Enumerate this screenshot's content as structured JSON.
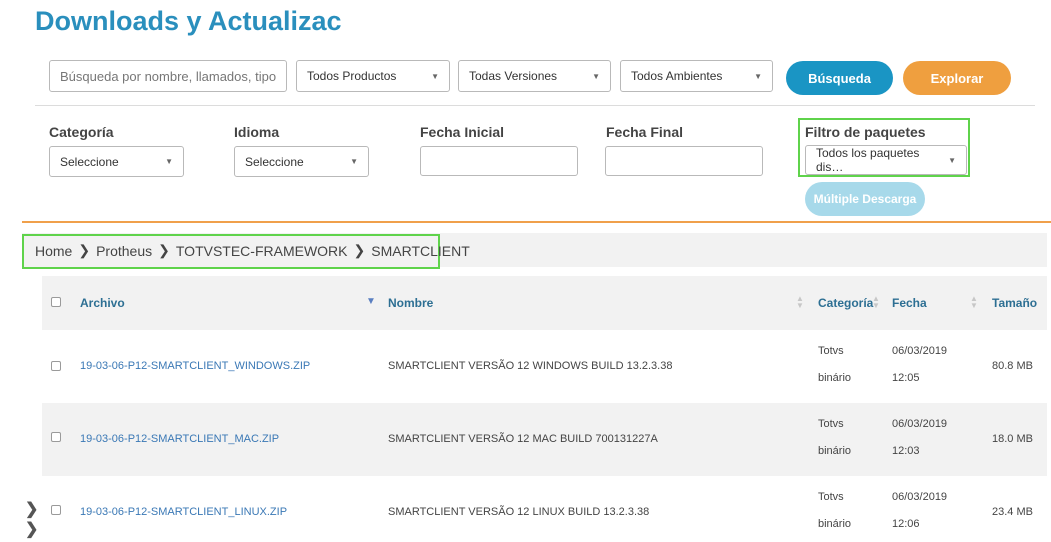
{
  "page": {
    "title": "Downloads y Actualizac"
  },
  "search": {
    "placeholder": "Búsqueda por nombre, llamados, tipo .",
    "products_select": "Todos Productos",
    "versions_select": "Todas Versiones",
    "environments_select": "Todos Ambientes",
    "search_button": "Búsqueda",
    "explore_button": "Explorar"
  },
  "filters": {
    "category_label": "Categoría",
    "category_value": "Seleccione",
    "language_label": "Idioma",
    "language_value": "Seleccione",
    "start_date_label": "Fecha Inicial",
    "end_date_label": "Fecha Final",
    "package_filter_label": "Filtro de paquetes",
    "package_filter_value": "Todos los paquetes dis…",
    "multi_download_button": "Múltiple Descarga"
  },
  "breadcrumb": [
    "Home",
    "Protheus",
    "TOTVSTEC-FRAMEWORK",
    "SMARTCLIENT"
  ],
  "table": {
    "headers": {
      "file": "Archivo",
      "name": "Nombre",
      "category": "Categoría",
      "date": "Fecha",
      "size": "Tamaño"
    },
    "rows": [
      {
        "file": "19-03-06-P12-SMARTCLIENT_WINDOWS.ZIP",
        "name": "SMARTCLIENT VERSÃO 12 WINDOWS BUILD 13.2.3.38",
        "category_line1": "Totvs",
        "category_line2": "binário",
        "date": "06/03/2019",
        "time": "12:05",
        "size": "80.8 MB"
      },
      {
        "file": "19-03-06-P12-SMARTCLIENT_MAC.ZIP",
        "name": "SMARTCLIENT VERSÃO 12 MAC BUILD 700131227A",
        "category_line1": "Totvs",
        "category_line2": "binário",
        "date": "06/03/2019",
        "time": "12:03",
        "size": "18.0 MB"
      },
      {
        "file": "19-03-06-P12-SMARTCLIENT_LINUX.ZIP",
        "name": "SMARTCLIENT VERSÃO 12 LINUX BUILD 13.2.3.38",
        "category_line1": "Totvs",
        "category_line2": "binário",
        "date": "06/03/2019",
        "time": "12:06",
        "size": "23.4 MB"
      }
    ]
  },
  "colors": {
    "title": "#2a8fbd",
    "search_button": "#1a95c4",
    "explore_button": "#ef9f3f",
    "highlight": "#5fd34b",
    "link": "#3a78b5"
  },
  "icons": {
    "select_caret": "chevron-down-icon",
    "breadcrumb_separator": "chevron-right-icon",
    "sort": "sort-icon"
  }
}
